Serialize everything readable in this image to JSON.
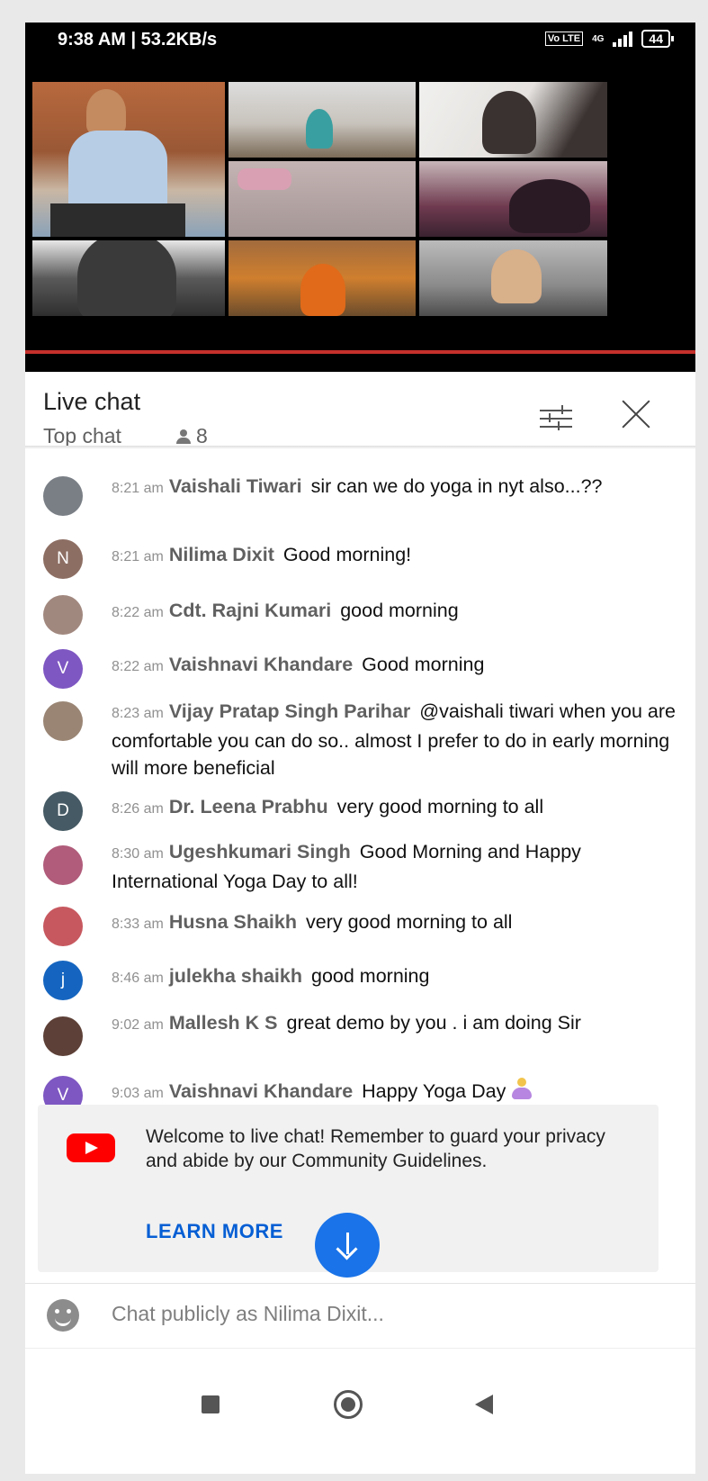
{
  "statusbar": {
    "time_speed": "9:38 AM | 53.2KB/s",
    "network": "4G",
    "volte": "Vo LTE",
    "battery": "44"
  },
  "chat_header": {
    "title": "Live chat",
    "mode": "Top chat",
    "viewer_count": "8"
  },
  "messages": [
    {
      "time": "8:21 am",
      "author": "Vaishali Tiwari",
      "text": "sir can we do yoga in nyt also...??",
      "avatar_letter": "",
      "avatar_color": "#7a7f86"
    },
    {
      "time": "8:21 am",
      "author": "Nilima Dixit",
      "text": "Good morning!",
      "avatar_letter": "N",
      "avatar_color": "#8d6e63"
    },
    {
      "time": "8:22 am",
      "author": "Cdt. Rajni Kumari",
      "text": "good morning",
      "avatar_letter": "",
      "avatar_color": "#a1887f"
    },
    {
      "time": "8:22 am",
      "author": "Vaishnavi Khandare",
      "text": "Good morning",
      "avatar_letter": "V",
      "avatar_color": "#7e57c2"
    },
    {
      "time": "8:23 am",
      "author": "Vijay Pratap Singh Parihar",
      "text": "@vaishali tiwari when you are comfortable you can do so.. almost I prefer to do in early morning will more beneficial",
      "avatar_letter": "",
      "avatar_color": "#9a8574"
    },
    {
      "time": "8:26 am",
      "author": "Dr. Leena Prabhu",
      "text": "very good morning to all",
      "avatar_letter": "D",
      "avatar_color": "#455a64"
    },
    {
      "time": "8:30 am",
      "author": "Ugeshkumari Singh",
      "text": "Good Morning and Happy International Yoga Day to all!",
      "avatar_letter": "",
      "avatar_color": "#b05c7a"
    },
    {
      "time": "8:33 am",
      "author": "Husna Shaikh",
      "text": "very good morning to all",
      "avatar_letter": "",
      "avatar_color": "#c7585f"
    },
    {
      "time": "8:46 am",
      "author": "julekha shaikh",
      "text": "good morning",
      "avatar_letter": "j",
      "avatar_color": "#1565c0"
    },
    {
      "time": "9:02 am",
      "author": "Mallesh K S",
      "text": "great demo by you . i am doing Sir",
      "avatar_letter": "",
      "avatar_color": "#5d4037"
    },
    {
      "time": "9:03 am",
      "author": "Vaishnavi Khandare",
      "text": "Happy Yoga Day",
      "avatar_letter": "V",
      "avatar_color": "#7e57c2"
    }
  ],
  "welcome": {
    "text": "Welcome to live chat! Remember to guard your privacy and abide by our Community Guidelines.",
    "link": "LEARN MORE"
  },
  "input": {
    "placeholder": "Chat publicly as Nilima Dixit..."
  },
  "colors": {
    "accent": "#065fd4",
    "scroll_button": "#1a73e8",
    "progress": "#c4302b",
    "youtube": "#ff0000"
  }
}
